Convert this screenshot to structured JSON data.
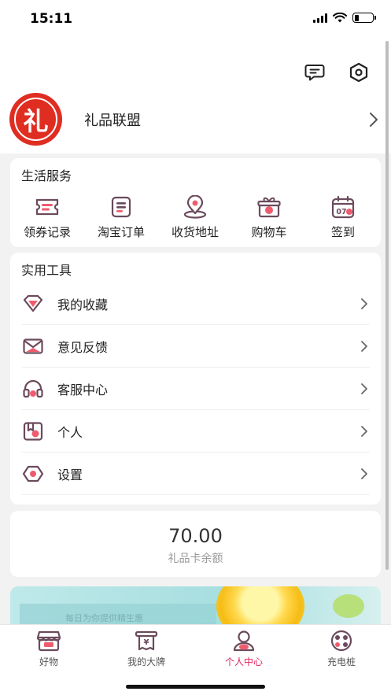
{
  "status_bar": {
    "time": "15:11",
    "battery_level": 0.25
  },
  "header": {
    "chat_icon": "chat-bubble-icon",
    "settings_icon": "hexagon-settings-icon"
  },
  "profile": {
    "avatar_char": "礼",
    "name": "礼品联盟"
  },
  "services": {
    "title": "生活服务",
    "items": [
      {
        "label": "领券记录",
        "icon": "coupon-icon"
      },
      {
        "label": "淘宝订单",
        "icon": "order-icon"
      },
      {
        "label": "收货地址",
        "icon": "location-icon"
      },
      {
        "label": "购物车",
        "icon": "gift-cart-icon"
      },
      {
        "label": "签到",
        "icon": "calendar-icon",
        "badge": "07"
      }
    ]
  },
  "tools": {
    "title": "实用工具",
    "items": [
      {
        "label": "我的收藏",
        "icon": "diamond-icon"
      },
      {
        "label": "意见反馈",
        "icon": "mail-icon"
      },
      {
        "label": "客服中心",
        "icon": "headset-icon"
      },
      {
        "label": "个人",
        "icon": "person-card-icon"
      },
      {
        "label": "设置",
        "icon": "settings-icon"
      }
    ]
  },
  "balance": {
    "value": "70.00",
    "label": "礼品卡余额"
  },
  "banner": {
    "text": "每日为你提供精生惠"
  },
  "tabbar": {
    "active_color": "#e0245e",
    "items": [
      {
        "label": "好物",
        "icon": "shop-icon"
      },
      {
        "label": "我的大牌",
        "icon": "yen-receipt-icon"
      },
      {
        "label": "个人中心",
        "icon": "person-icon",
        "active": true
      },
      {
        "label": "充电桩",
        "icon": "charger-icon"
      }
    ]
  },
  "colors": {
    "accent": "#e0245e",
    "icon_stroke": "#6b4a5c",
    "avatar_red": "#e02d22"
  }
}
